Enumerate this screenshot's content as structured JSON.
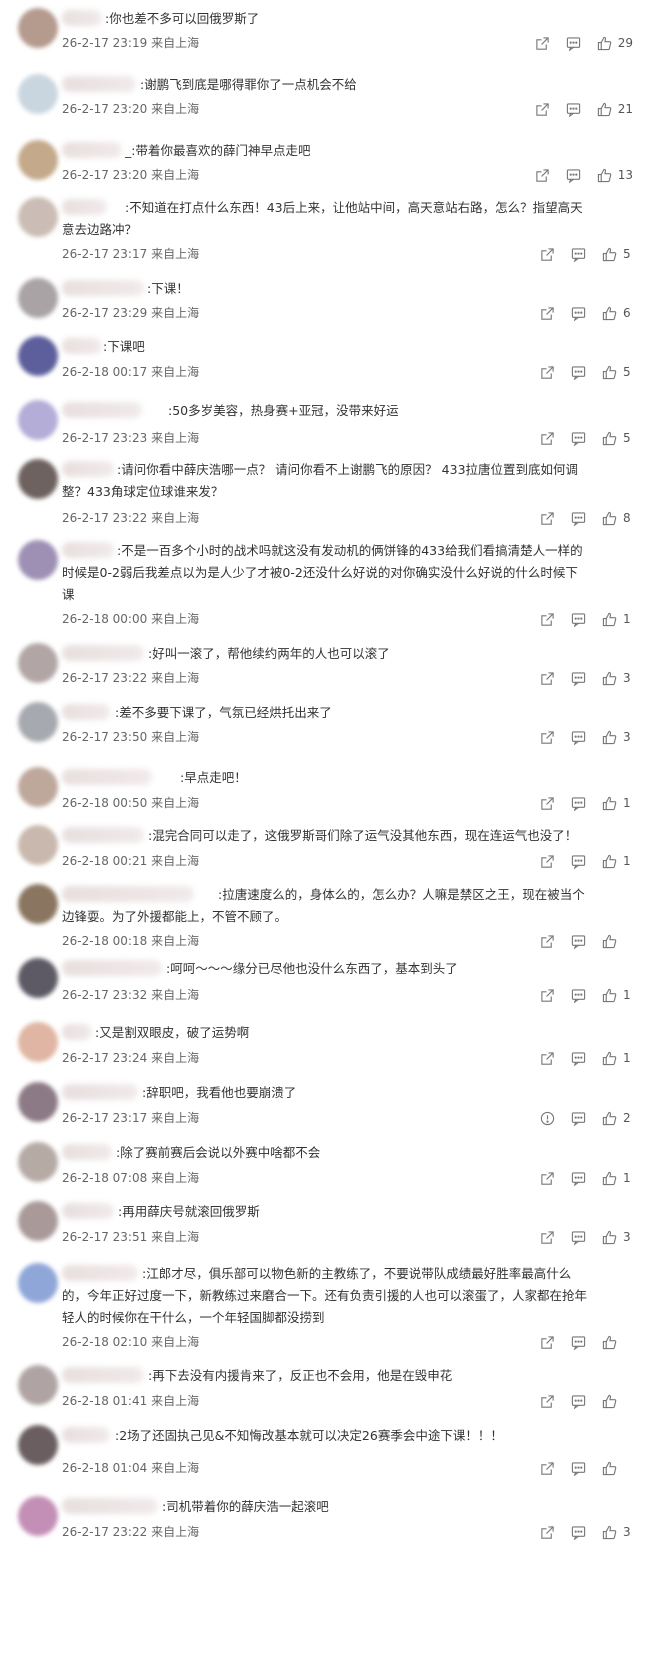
{
  "comments": [
    {
      "text": ":你也差不多可以回俄罗斯了",
      "time": "26-2-17 23:19",
      "location": "来自上海",
      "likes": "29",
      "avatar_color": "#b59a8e"
    },
    {
      "text": ":谢鹏飞到底是哪得罪你了一点机会不给",
      "time": "26-2-17 23:20",
      "location": "来自上海",
      "likes": "21",
      "avatar_color": "#c9d6e0"
    },
    {
      "text": "_:带着你最喜欢的薛门神早点走吧",
      "time": "26-2-17 23:20",
      "location": "来自上海",
      "likes": "13",
      "avatar_color": "#c4a98a"
    },
    {
      "text": ":不知道在打点什么东西！43后上来，让他站中间，高天意站右路，怎么？指望高天意去边路冲？",
      "time": "26-2-17 23:17",
      "location": "来自上海",
      "likes": "5",
      "avatar_color": "#cbbdb5"
    },
    {
      "text": ":下课！",
      "time": "26-2-17 23:29",
      "location": "来自上海",
      "likes": "6",
      "avatar_color": "#a9a3a6"
    },
    {
      "text": ":下课吧",
      "time": "26-2-18 00:17",
      "location": "来自上海",
      "likes": "5",
      "avatar_color": "#5c5f9b"
    },
    {
      "text": ":50多岁美容，热身赛+亚冠，没带来好运",
      "time": "26-2-17 23:23",
      "location": "来自上海",
      "likes": "5",
      "avatar_color": "#b3add8"
    },
    {
      "text": ":请问你看中薛庆浩哪一点？ 请问你看不上谢鹏飞的原因？ 433拉唐位置到底如何调整？433角球定位球谁来发？",
      "time": "26-2-17 23:22",
      "location": "来自上海",
      "likes": "8",
      "avatar_color": "#6e625f"
    },
    {
      "text": ":不是一百多个小时的战术吗就这没有发动机的俩饼锋的433给我们看搞清楚人一样的时候是0-2弱后我差点以为是人少了才被0-2还没什么好说的对你确实没什么好说的什么时候下课",
      "time": "26-2-18 00:00",
      "location": "来自上海",
      "likes": "1",
      "avatar_color": "#9e8fb4"
    },
    {
      "text": ":好叫一滚了，帮他续约两年的人也可以滚了",
      "time": "26-2-17 23:22",
      "location": "来自上海",
      "likes": "3",
      "avatar_color": "#b2a5a5"
    },
    {
      "text": ":差不多要下课了，气氛已经烘托出来了",
      "time": "26-2-17 23:50",
      "location": "来自上海",
      "likes": "3",
      "avatar_color": "#a7a9b0"
    },
    {
      "text": ":早点走吧！",
      "time": "26-2-18 00:50",
      "location": "来自上海",
      "likes": "1",
      "avatar_color": "#bea79b"
    },
    {
      "text": ":混完合同可以走了，这俄罗斯哥们除了运气没其他东西，现在连运气也没了！",
      "time": "26-2-18 00:21",
      "location": "来自上海",
      "likes": "1",
      "avatar_color": "#c9b8ad"
    },
    {
      "text": ":拉唐速度么的，身体么的，怎么办？人嘛是禁区之王，现在被当个边锋耍。为了外援都能上，不管不顾了。",
      "time": "26-2-18 00:18",
      "location": "来自上海",
      "likes": "",
      "avatar_color": "#8a7560"
    },
    {
      "text": ":呵呵～～～缘分已尽他也没什么东西了，基本到头了",
      "time": "26-2-17 23:32",
      "location": "来自上海",
      "likes": "1",
      "avatar_color": "#5d5a66"
    },
    {
      "text": ":又是割双眼皮，破了运势啊",
      "time": "26-2-17 23:24",
      "location": "来自上海",
      "likes": "1",
      "avatar_color": "#e0b5a3"
    },
    {
      "text": ":辞职吧，我看他也要崩溃了",
      "time": "26-2-17 23:17",
      "location": "来自上海",
      "likes": "2",
      "avatar_color": "#8c7a86"
    },
    {
      "text": ":除了赛前赛后会说以外赛中啥都不会",
      "time": "26-2-18 07:08",
      "location": "来自上海",
      "likes": "1",
      "avatar_color": "#b6aaa5"
    },
    {
      "text": ":再用薛庆号就滚回俄罗斯",
      "time": "26-2-17 23:51",
      "location": "来自上海",
      "likes": "3",
      "avatar_color": "#a99a99"
    },
    {
      "text": ":江郎才尽，俱乐部可以物色新的主教练了，不要说带队成绩最好胜率最高什么的，今年正好过度一下，新教练过来磨合一下。还有负责引援的人也可以滚蛋了，人家都在抢年轻人的时候你在干什么，一个年轻国脚都没捞到",
      "time": "26-2-18 02:10",
      "location": "来自上海",
      "likes": "",
      "avatar_color": "#8fa6d8"
    },
    {
      "text": ":再下去没有内援肯来了，反正也不会用，他是在毁申花",
      "time": "26-2-18 01:41",
      "location": "来自上海",
      "likes": "",
      "avatar_color": "#b0a3a3"
    },
    {
      "text": ":2场了还固执己见&不知悔改基本就可以决定26赛季会中途下课！！！",
      "time": "26-2-18 01:04",
      "location": "来自上海",
      "likes": "",
      "avatar_color": "#6a5e60"
    },
    {
      "text": ":司机带着你的薛庆浩一起滚吧",
      "time": "26-2-17 23:22",
      "location": "来自上海",
      "likes": "3",
      "avatar_color": "#c48fb6"
    }
  ]
}
